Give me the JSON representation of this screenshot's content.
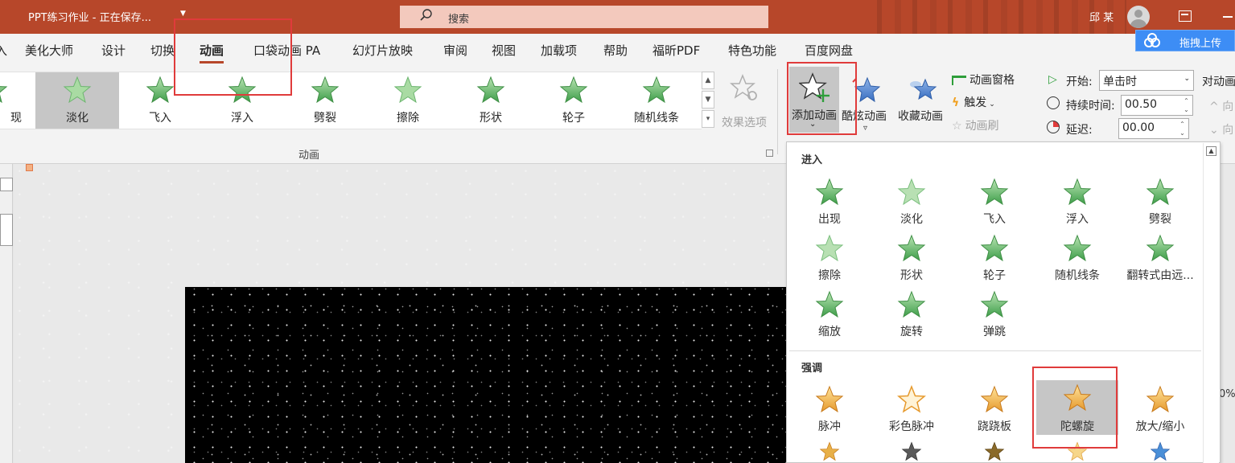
{
  "app": {
    "doc_title": "PPT练习作业 - 正在保存...",
    "search_placeholder": "搜索",
    "user_name": "邱 某",
    "upload_label": "拖拽上传"
  },
  "tabs": {
    "edge": "入",
    "items": [
      "美化大师",
      "设计",
      "切换",
      "动画",
      "口袋动画 PA",
      "幻灯片放映",
      "审阅",
      "视图",
      "加载项",
      "帮助",
      "福昕PDF",
      "特色功能",
      "百度网盘"
    ],
    "active": "动画"
  },
  "ribbon": {
    "gallery": [
      "现",
      "淡化",
      "飞入",
      "浮入",
      "劈裂",
      "擦除",
      "形状",
      "轮子",
      "随机线条"
    ],
    "group_label": "动画",
    "effect_options": "效果选项",
    "add_animation": "添加动画",
    "cool_animation": "酷炫动画",
    "fav_animation": "收藏动画",
    "animation_pane": "动画窗格",
    "trigger": "触发",
    "animation_painter": "动画刷",
    "start_label": "开始:",
    "start_value": "单击时",
    "duration_label": "持续时间:",
    "duration_value": "00.50",
    "delay_label": "延迟:",
    "delay_value": "00.00",
    "reorder_label": "对动画",
    "reorder_up": "向",
    "reorder_down": "向"
  },
  "panel": {
    "entrance_header": "进入",
    "entrance": [
      "出现",
      "淡化",
      "飞入",
      "浮入",
      "劈裂",
      "擦除",
      "形状",
      "轮子",
      "随机线条",
      "翻转式由远...",
      "缩放",
      "旋转",
      "弹跳"
    ],
    "emphasis_header": "强调",
    "emphasis": [
      "脉冲",
      "彩色脉冲",
      "跷跷板",
      "陀螺旋",
      "放大/缩小"
    ],
    "highlighted": "陀螺旋"
  },
  "status": {
    "zoom_fragment": "0%"
  },
  "colors": {
    "accent": "#b7472a",
    "highlight_box": "#e03b3b",
    "green_star": "#5cb85c",
    "gold_star": "#f2b84b"
  }
}
